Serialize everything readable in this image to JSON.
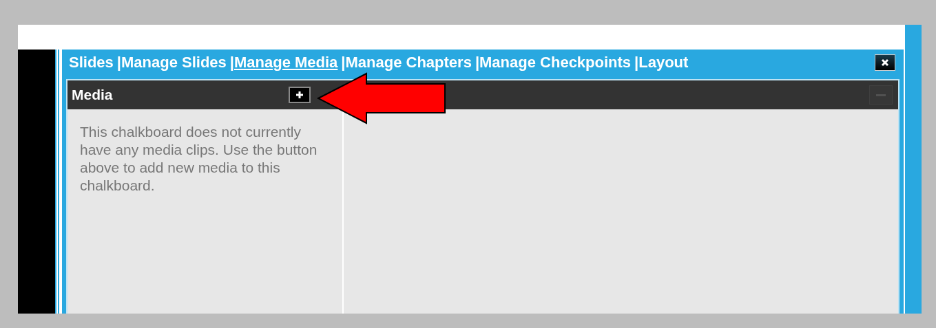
{
  "nav": {
    "separator": "|",
    "tabs": [
      {
        "label": "Slides",
        "selected": false
      },
      {
        "label": "Manage Slides",
        "selected": false
      },
      {
        "label": "Manage Media",
        "selected": true
      },
      {
        "label": "Manage Chapters",
        "selected": false
      },
      {
        "label": "Manage Checkpoints",
        "selected": false
      },
      {
        "label": "Layout",
        "selected": false
      }
    ]
  },
  "media_panel": {
    "title": "Media",
    "message": "This chalkboard does not currently have any media clips. Use the button above to add new media to this chalkboard."
  },
  "detail_panel": {
    "collapse_disabled": true
  }
}
